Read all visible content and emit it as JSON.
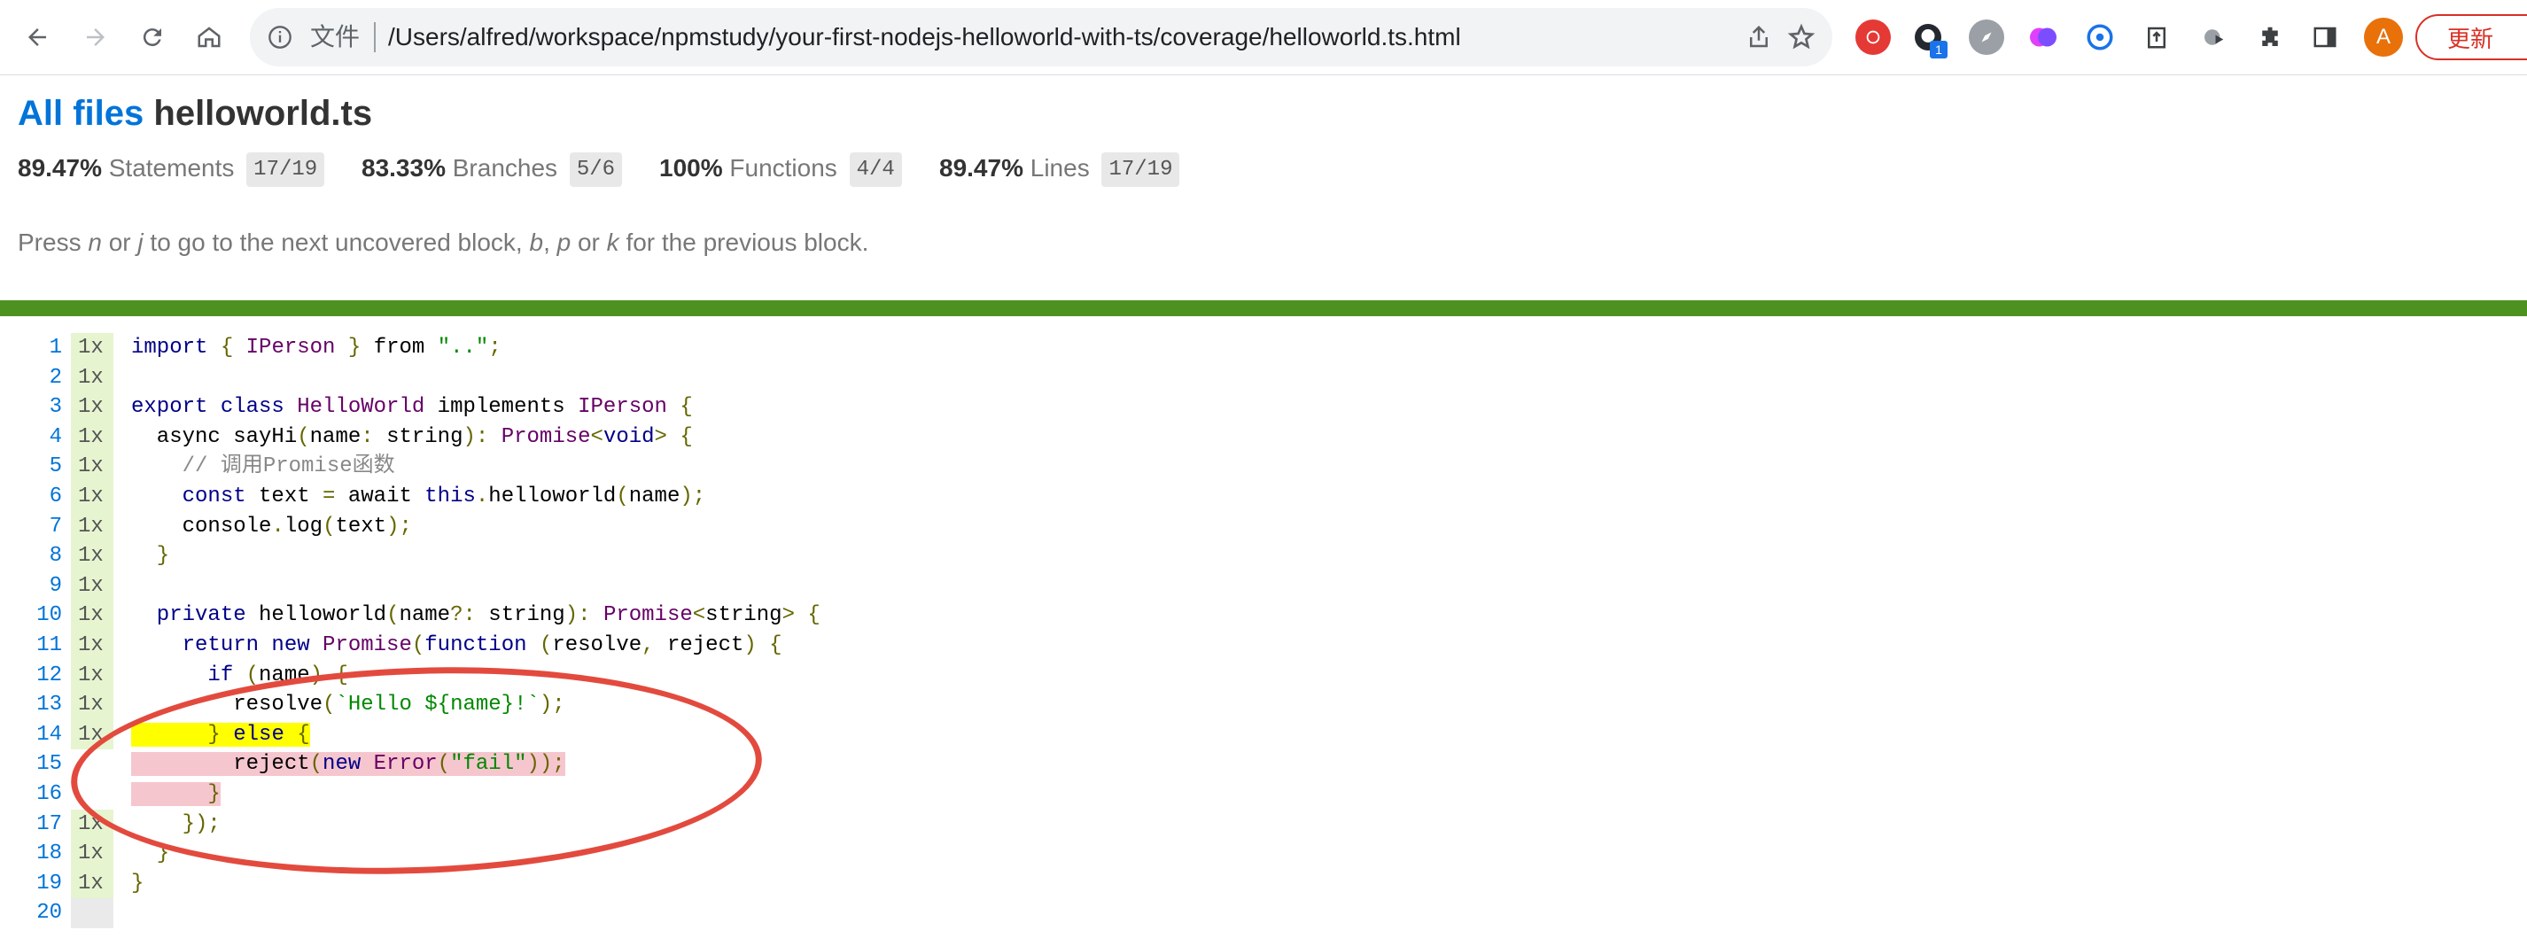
{
  "browser": {
    "scheme_label": "文件",
    "url": "/Users/alfred/workspace/npmstudy/your-first-nodejs-helloworld-with-ts/coverage/helloworld.ts.html",
    "extension_badge": "1",
    "profile_initial": "A",
    "update_label": "更新",
    "icons": [
      "back-icon",
      "forward-icon",
      "reload-icon",
      "home-icon",
      "info-icon",
      "share-icon",
      "star-icon",
      "extensions-icon",
      "side-panel-icon"
    ]
  },
  "report": {
    "breadcrumb_link": "All files",
    "file_name": "helloworld.ts",
    "metrics": [
      {
        "pct": "89.47%",
        "label": "Statements",
        "fraction": "17/19"
      },
      {
        "pct": "83.33%",
        "label": "Branches",
        "fraction": "5/6"
      },
      {
        "pct": "100%",
        "label": "Functions",
        "fraction": "4/4"
      },
      {
        "pct": "89.47%",
        "label": "Lines",
        "fraction": "17/19"
      }
    ],
    "hint": {
      "p1": "Press ",
      "k1": "n",
      "p2": " or ",
      "k2": "j",
      "p3": " to go to the next uncovered block, ",
      "k3": "b",
      "p4": ", ",
      "k4": "p",
      "p5": " or ",
      "k5": "k",
      "p6": " for the previous block."
    },
    "status_color": "#4d9221",
    "lines": [
      {
        "n": "1",
        "hits": "1x",
        "code": [
          [
            "kw",
            "import"
          ],
          [
            "pun",
            " { "
          ],
          [
            "typ",
            "IPerson"
          ],
          [
            "pun",
            " } "
          ],
          [
            "",
            "from "
          ],
          [
            "str",
            "\"..\""
          ],
          [
            "pun",
            ";"
          ]
        ]
      },
      {
        "n": "2",
        "hits": "1x",
        "code": []
      },
      {
        "n": "3",
        "hits": "1x",
        "code": [
          [
            "kw",
            "export class "
          ],
          [
            "typ",
            "HelloWorld"
          ],
          [
            "",
            " implements "
          ],
          [
            "typ",
            "IPerson"
          ],
          [
            "pun",
            " {"
          ]
        ]
      },
      {
        "n": "4",
        "hits": "1x",
        "code": [
          [
            "",
            "  async sayHi"
          ],
          [
            "pun",
            "("
          ],
          [
            "",
            "name"
          ],
          [
            "pun",
            ": "
          ],
          [
            "",
            "string"
          ],
          [
            "pun",
            "): "
          ],
          [
            "typ",
            "Promise"
          ],
          [
            "pun",
            "<"
          ],
          [
            "kw",
            "void"
          ],
          [
            "pun",
            "> {"
          ]
        ]
      },
      {
        "n": "5",
        "hits": "1x",
        "code": [
          [
            "com",
            "    // 调用Promise函数"
          ]
        ]
      },
      {
        "n": "6",
        "hits": "1x",
        "code": [
          [
            "kw",
            "    const"
          ],
          [
            "",
            " text "
          ],
          [
            "pun",
            "= "
          ],
          [
            "",
            "await "
          ],
          [
            "kw",
            "this"
          ],
          [
            "pun",
            "."
          ],
          [
            "",
            "helloworld"
          ],
          [
            "pun",
            "("
          ],
          [
            "",
            "name"
          ],
          [
            "pun",
            ");"
          ]
        ]
      },
      {
        "n": "7",
        "hits": "1x",
        "code": [
          [
            "",
            "    console"
          ],
          [
            "pun",
            "."
          ],
          [
            "",
            "log"
          ],
          [
            "pun",
            "("
          ],
          [
            "",
            "text"
          ],
          [
            "pun",
            ");"
          ]
        ]
      },
      {
        "n": "8",
        "hits": "1x",
        "code": [
          [
            "pun",
            "  }"
          ]
        ]
      },
      {
        "n": "9",
        "hits": "1x",
        "code": []
      },
      {
        "n": "10",
        "hits": "1x",
        "code": [
          [
            "kw",
            "  private"
          ],
          [
            "",
            " helloworld"
          ],
          [
            "pun",
            "("
          ],
          [
            "",
            "name"
          ],
          [
            "pun",
            "?: "
          ],
          [
            "",
            "string"
          ],
          [
            "pun",
            "): "
          ],
          [
            "typ",
            "Promise"
          ],
          [
            "pun",
            "<"
          ],
          [
            "",
            "string"
          ],
          [
            "pun",
            "> {"
          ]
        ]
      },
      {
        "n": "11",
        "hits": "1x",
        "code": [
          [
            "kw",
            "    return new "
          ],
          [
            "typ",
            "Promise"
          ],
          [
            "pun",
            "("
          ],
          [
            "kw",
            "function"
          ],
          [
            "pun",
            " ("
          ],
          [
            "",
            "resolve"
          ],
          [
            "pun",
            ", "
          ],
          [
            "",
            "reject"
          ],
          [
            "pun",
            ") {"
          ]
        ]
      },
      {
        "n": "12",
        "hits": "1x",
        "code": [
          [
            "kw",
            "      if"
          ],
          [
            "pun",
            " ("
          ],
          [
            "",
            "name"
          ],
          [
            "pun",
            ") {"
          ]
        ]
      },
      {
        "n": "13",
        "hits": "1x",
        "code": [
          [
            "",
            "        resolve"
          ],
          [
            "pun",
            "("
          ],
          [
            "str",
            "`Hello ${name}!`"
          ],
          [
            "pun",
            ");"
          ]
        ]
      },
      {
        "n": "14",
        "hits": "1x",
        "code": [
          [
            "hl-yellow",
            "      "
          ],
          [
            "hl-yellow pun",
            "} "
          ],
          [
            "hl-yellow kw",
            "else"
          ],
          [
            "hl-yellow pun",
            " {"
          ]
        ]
      },
      {
        "n": "15",
        "hits": "",
        "code": [
          [
            "hl-red",
            "        reject"
          ],
          [
            "hl-red pun",
            "("
          ],
          [
            "hl-red kw",
            "new "
          ],
          [
            "hl-red typ",
            "Error"
          ],
          [
            "hl-red pun",
            "("
          ],
          [
            "hl-red str",
            "\"fail\""
          ],
          [
            "hl-red pun",
            "));"
          ]
        ]
      },
      {
        "n": "16",
        "hits": "",
        "code": [
          [
            "hl-red pun",
            "      }"
          ]
        ]
      },
      {
        "n": "17",
        "hits": "1x",
        "code": [
          [
            "pun",
            "    });"
          ]
        ]
      },
      {
        "n": "18",
        "hits": "1x",
        "code": [
          [
            "pun",
            "  }"
          ]
        ]
      },
      {
        "n": "19",
        "hits": "1x",
        "code": [
          [
            "pun",
            "}"
          ]
        ]
      },
      {
        "n": "20",
        "hits": "",
        "code": []
      }
    ]
  }
}
